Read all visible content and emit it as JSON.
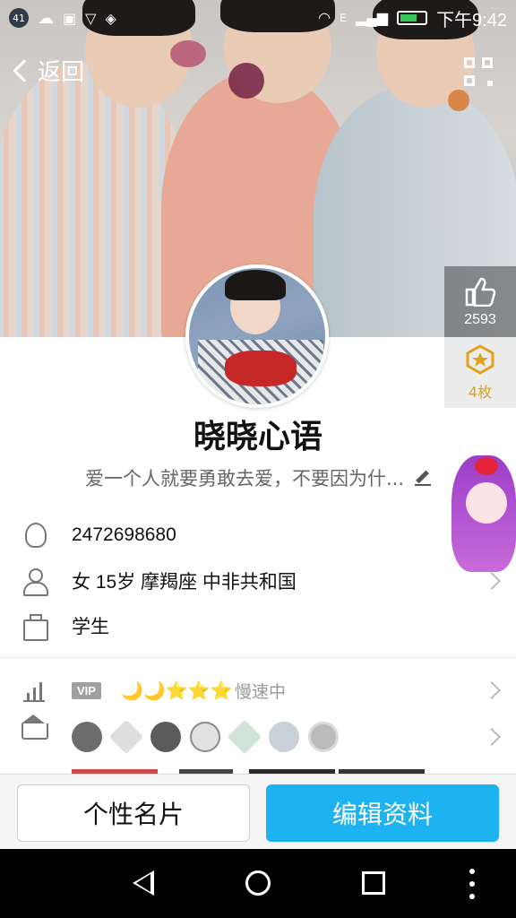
{
  "status_bar": {
    "notification_count": "41",
    "time": "下午9:42",
    "network": "E"
  },
  "nav": {
    "back_label": "返回"
  },
  "stats": {
    "likes": "2593",
    "medals": "4枚"
  },
  "profile": {
    "name": "晓晓心语",
    "bio": "爱一个人就要勇敢去爱，不要因为什..."
  },
  "info": {
    "qq_number": "2472698680",
    "details": "女  15岁  摩羯座  中非共和国",
    "occupation": "学生"
  },
  "vip": {
    "badge": "VIP",
    "level_icons": "🌙🌙⭐⭐⭐",
    "status": "慢速中"
  },
  "actions": {
    "card_label": "个性名片",
    "edit_label": "编辑资料"
  },
  "colors": {
    "accent": "#1fb2f0",
    "medal": "#e0a21b"
  }
}
